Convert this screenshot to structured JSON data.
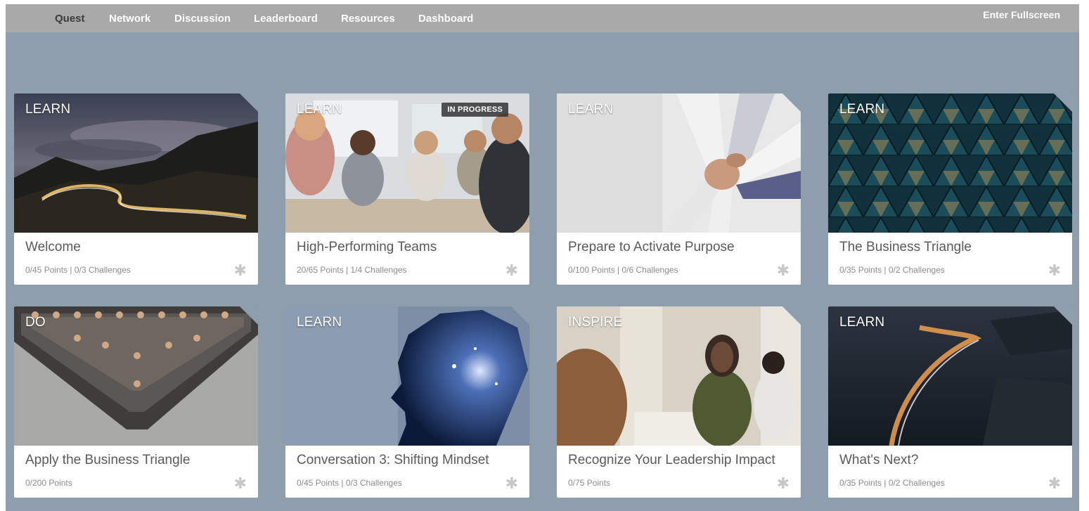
{
  "nav": {
    "items": [
      "Quest",
      "Network",
      "Discussion",
      "Leaderboard",
      "Resources",
      "Dashboard"
    ],
    "active": "Quest",
    "fullscreen_label": "Enter Fullscreen"
  },
  "cards": [
    {
      "type": "LEARN",
      "title": "Welcome",
      "stats": "0/45 Points | 0/3 Challenges",
      "badge": ""
    },
    {
      "type": "LEARN",
      "title": "High-Performing Teams",
      "stats": "20/65 Points | 1/4 Challenges",
      "badge": "IN PROGRESS"
    },
    {
      "type": "LEARN",
      "title": "Prepare to Activate Purpose",
      "stats": "0/100 Points | 0/6 Challenges",
      "badge": ""
    },
    {
      "type": "LEARN",
      "title": "The Business Triangle",
      "stats": "0/35 Points | 0/2 Challenges",
      "badge": ""
    },
    {
      "type": "DO",
      "title": "Apply the Business Triangle",
      "stats": "0/200 Points",
      "badge": ""
    },
    {
      "type": "LEARN",
      "title": "Conversation 3: Shifting Mindset",
      "stats": "0/45 Points | 0/3 Challenges",
      "badge": ""
    },
    {
      "type": "INSPIRE",
      "title": "Recognize Your Leadership Impact",
      "stats": "0/75 Points",
      "badge": ""
    },
    {
      "type": "LEARN",
      "title": "What's Next?",
      "stats": "0/35 Points | 0/2 Challenges",
      "badge": ""
    }
  ],
  "icons": {
    "card_status": "puzzle-piece-icon"
  },
  "colors": {
    "background": "#8f9eac",
    "nav_bar": "#a9a9a9",
    "nav_active": "#3b3b3b",
    "card_background": "#ffffff"
  }
}
